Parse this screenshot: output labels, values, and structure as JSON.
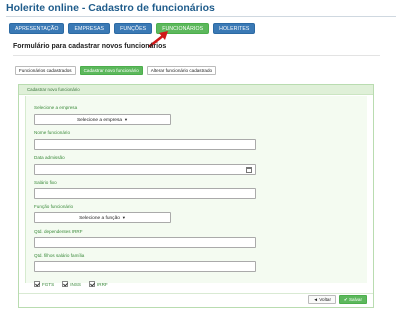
{
  "page": {
    "title": "Holerite online - Cadastro de funcionários"
  },
  "nav": {
    "items": [
      {
        "label": "APRESENTAÇÃO"
      },
      {
        "label": "EMPRESAS"
      },
      {
        "label": "FUNÇÕES"
      },
      {
        "label": "FUNCIONÁRIOS",
        "active": true
      },
      {
        "label": "HOLERITES"
      }
    ]
  },
  "form": {
    "title": "Formulário para cadastrar novos funcionários"
  },
  "tabs": [
    {
      "label": "Funcionários cadastrados"
    },
    {
      "label": "Cadastrar novo funcionário",
      "active": true
    },
    {
      "label": "Alterar funcionário cadastrado"
    }
  ],
  "panel": {
    "heading": "Cadastrar novo funcionário",
    "company_label": "Selecione a empresa",
    "company_select": "Selecione a empresa",
    "name_label": "Nome funcionário",
    "admission_label": "Data admissão",
    "salary_label": "Salário fixo",
    "role_label": "Função funcionário",
    "role_select": "Selecione a função",
    "irrf_label": "Qtd. dependentes IRRF",
    "family_label": "Qtd. filhos salário família",
    "checks": [
      {
        "label": "FGTS"
      },
      {
        "label": "INSS"
      },
      {
        "label": "IRRF"
      }
    ],
    "back_label": "Voltar",
    "save_label": "Salvar"
  },
  "colors": {
    "primary": "#3a79b5",
    "success": "#5cb85c",
    "title": "#1f5c8b",
    "arrow": "#d01818"
  },
  "icons": {
    "back": "arrow-left-icon",
    "save": "check-icon",
    "calendar": "calendar-icon",
    "caret": "caret-down-icon"
  }
}
